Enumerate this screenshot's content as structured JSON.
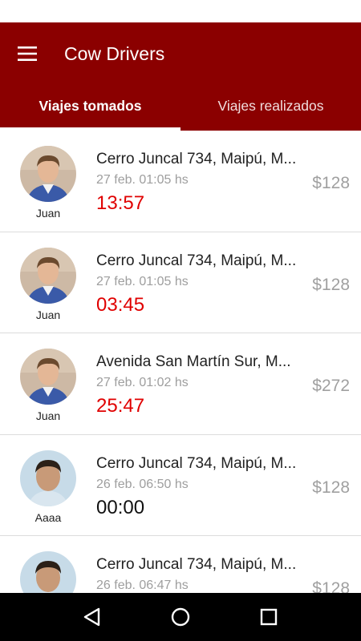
{
  "app": {
    "title": "Cow Drivers",
    "accent_color": "#8b0000",
    "timer_color": "#e00000"
  },
  "tabs": [
    {
      "label": "Viajes tomados",
      "active": true
    },
    {
      "label": "Viajes realizados",
      "active": false
    }
  ],
  "trips": [
    {
      "driver": "Juan",
      "address": "Cerro Juncal 734, Maipú, M...",
      "date": "27 feb. 01:05 hs",
      "timer": "13:57",
      "timer_color": "#e00000",
      "price": "$128",
      "avatar": "avatar-juan"
    },
    {
      "driver": "Juan",
      "address": "Cerro Juncal 734, Maipú, M...",
      "date": "27 feb. 01:05 hs",
      "timer": "03:45",
      "timer_color": "#e00000",
      "price": "$128",
      "avatar": "avatar-juan"
    },
    {
      "driver": "Juan",
      "address": "Avenida San Martín Sur, M...",
      "date": "27 feb. 01:02 hs",
      "timer": "25:47",
      "timer_color": "#e00000",
      "price": "$272",
      "avatar": "avatar-juan"
    },
    {
      "driver": "Aaaa",
      "address": "Cerro Juncal 734, Maipú, M...",
      "date": "26 feb. 06:50 hs",
      "timer": "00:00",
      "timer_color": "#111111",
      "price": "$128",
      "avatar": "avatar-aaaa"
    },
    {
      "driver": "",
      "address": "Cerro Juncal 734, Maipú, M...",
      "date": "26 feb. 06:47 hs",
      "timer": "",
      "timer_color": "#111111",
      "price": "$128",
      "avatar": "avatar-aaaa"
    }
  ],
  "nav": {
    "back_icon": "back-triangle-icon",
    "home_icon": "home-circle-icon",
    "recents_icon": "recents-square-icon"
  }
}
